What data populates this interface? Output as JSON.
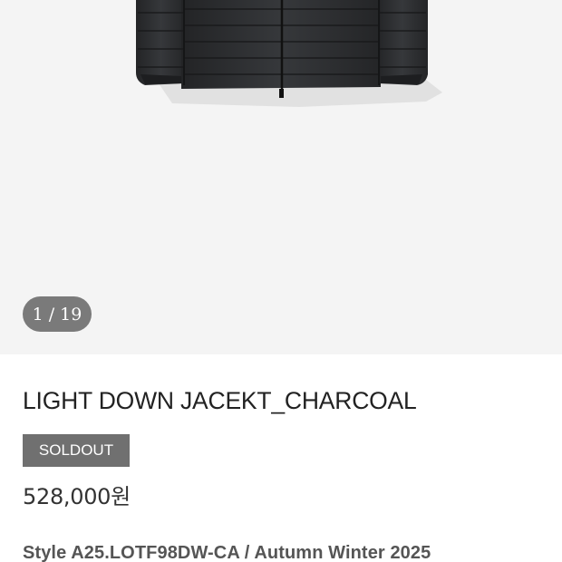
{
  "gallery": {
    "current": "1",
    "separator": "/",
    "total": "19",
    "image_subject": "charcoal-down-jacket"
  },
  "product": {
    "title": "LIGHT DOWN JACEKT_CHARCOAL",
    "status_badge": "SOLDOUT",
    "price": "528,000원",
    "style_line": "Style A25.LOTF98DW-CA / Autumn Winter 2025"
  },
  "colors": {
    "gallery_bg": "#f4f4f4",
    "badge_bg": "#707070",
    "counter_bg": "#646464",
    "jacket": "#2b2c2e"
  }
}
